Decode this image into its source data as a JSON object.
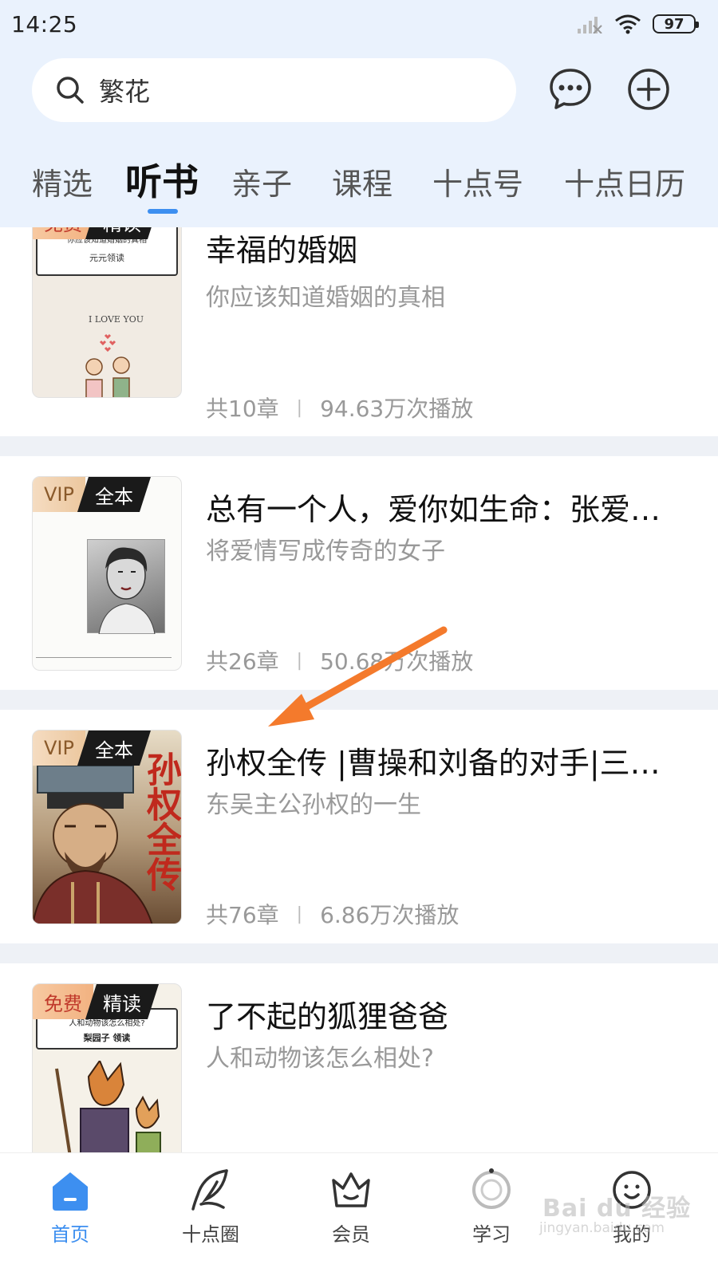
{
  "status_bar": {
    "time": "14:25",
    "battery": "97"
  },
  "search": {
    "value": "繁花"
  },
  "tabs": [
    {
      "label": "精选",
      "active": false
    },
    {
      "label": "听书",
      "active": true
    },
    {
      "label": "亲子",
      "active": false
    },
    {
      "label": "课程",
      "active": false
    },
    {
      "label": "十点号",
      "active": false
    },
    {
      "label": "十点日历",
      "active": false
    }
  ],
  "cards": [
    {
      "badge_a": "免费",
      "badge_b": "精读",
      "badge_type": "free",
      "cover_text_1": "你应该知道婚姻的真相",
      "cover_text_2": "元元领读",
      "cover_text_3": "I LOVE YOU",
      "title": "幸福的婚姻",
      "subtitle": "你应该知道婚姻的真相",
      "chapters": "共10章",
      "plays": "94.63万次播放"
    },
    {
      "badge_a": "VIP",
      "badge_b": "全本",
      "badge_type": "vip",
      "title": "总有一个人，爱你如生命：张爱…",
      "subtitle": "将爱情写成传奇的女子",
      "chapters": "共26章",
      "plays": "50.68万次播放"
    },
    {
      "badge_a": "VIP",
      "badge_b": "全本",
      "badge_type": "vip",
      "cover_text_1": "孙权全传",
      "title": "孙权全传 |曹操和刘备的对手|三…",
      "subtitle": "东吴主公孙权的一生",
      "chapters": "共76章",
      "plays": "6.86万次播放"
    },
    {
      "badge_a": "免费",
      "badge_b": "精读",
      "badge_type": "free",
      "cover_text_1": "人和动物该怎么相处?",
      "cover_text_2": "梨园子 领读",
      "title": "了不起的狐狸爸爸",
      "subtitle": "人和动物该怎么相处?"
    }
  ],
  "bottom_nav": [
    {
      "label": "首页",
      "icon": "home-icon",
      "active": true
    },
    {
      "label": "十点圈",
      "icon": "feather-icon",
      "active": false
    },
    {
      "label": "会员",
      "icon": "crown-icon",
      "active": false
    },
    {
      "label": "学习",
      "icon": "learn-icon",
      "active": false
    },
    {
      "label": "我的",
      "icon": "profile-icon",
      "active": false
    }
  ],
  "watermark": {
    "line1": "Bai du 经验",
    "line2": "jingyan.baidu.com"
  },
  "colors": {
    "accent": "#3d8ff0",
    "header_bg": "#eaf2fd",
    "arrow": "#f47a2c"
  }
}
